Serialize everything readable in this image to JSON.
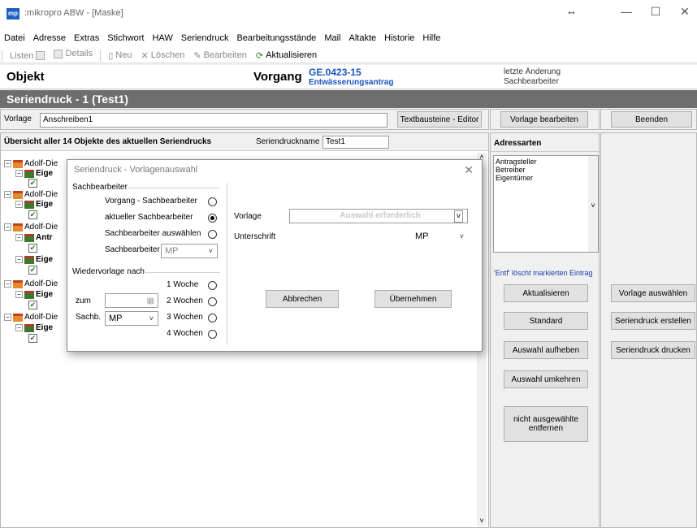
{
  "window": {
    "app_icon": "mp",
    "title": ":mikropro ABW - [Maske]"
  },
  "menu": [
    "Datei",
    "Adresse",
    "Extras",
    "Stichwort",
    "HAW",
    "Seriendruck",
    "Bearbeitungsstände",
    "Mail",
    "Altakte",
    "Historie",
    "Hilfe"
  ],
  "toolbar": {
    "listen": "Listen",
    "details": "Details",
    "neu": "Neu",
    "loeschen": "Löschen",
    "bearbeiten": "Bearbeiten",
    "aktualisieren": "Aktualisieren"
  },
  "header": {
    "objekt": "Objekt",
    "vorgang": "Vorgang",
    "vorgang_nr": "GE.0423-15",
    "vorgang_name": "Entwässerungsantrag",
    "letzte_aenderung": "letzte Änderung",
    "sachbearbeiter": "Sachbearbeiter"
  },
  "section_title": "Seriendruck - 1 (Test1)",
  "vorlage_row": {
    "label": "Vorlage",
    "value": "Anschreiben1",
    "textbausteine_btn": "Textbausteine - Editor",
    "vorlage_bearbeiten_btn": "Vorlage bearbeiten",
    "beenden_btn": "Beenden"
  },
  "overview": {
    "title": "Übersicht aller 14 Objekte des aktuellen Seriendrucks",
    "name_label": "Seriendruckname",
    "name_value": "Test1",
    "tree": [
      {
        "text": "Adolf-Die"
      },
      {
        "text": "Eige"
      },
      {
        "text": "Adolf-Die"
      },
      {
        "text": "Eige"
      },
      {
        "text": "Adolf-Die"
      },
      {
        "text": "Antr"
      },
      {
        "text": "Eige"
      },
      {
        "text": "Adolf-Die"
      },
      {
        "text": "Eige"
      },
      {
        "text": "Adolf-Die"
      },
      {
        "text": "Eige"
      }
    ]
  },
  "adressarten": {
    "title": "Adressarten",
    "items": [
      "Antragsteller",
      "Betreiber",
      "Eigentümer"
    ],
    "hint": "'Entf' löscht markierten Eintrag",
    "buttons": [
      "Aktualisieren",
      "Standard",
      "Auswahl aufheben",
      "Auswahl umkehren",
      "nicht ausgewählte entfernen"
    ]
  },
  "right_buttons": [
    "Vorlage auswählen",
    "Seriendruck erstellen",
    "Seriendruck drucken"
  ],
  "dialog": {
    "title": "Seriendruck - Vorlagenauswahl",
    "group_sachbearbeiter": "Sachbearbeiter",
    "opt_vorgang_sb": "Vorgang - Sachbearbeiter",
    "opt_aktueller_sb": "aktueller Sachbearbeiter",
    "opt_sb_auswaehlen": "Sachbearbeiter auswählen",
    "sb_label": "Sachbearbeiter",
    "sb_value": "MP",
    "group_wiedervorlage": "Wiedervorlage nach",
    "zum_label": "zum",
    "sachb_label": "Sachb.",
    "sachb_value": "MP",
    "w1": "1 Woche",
    "w2": "2 Wochen",
    "w3": "3 Wochen",
    "w4": "4 Wochen",
    "vorlage_label": "Vorlage",
    "vorlage_placeholder": "Auswahl erforderlich",
    "unterschrift_label": "Unterschrift",
    "unterschrift_value": "MP",
    "abbrechen": "Abbrechen",
    "uebernehmen": "Übernehmen"
  },
  "selected_radio": "aktueller Sachbearbeiter"
}
